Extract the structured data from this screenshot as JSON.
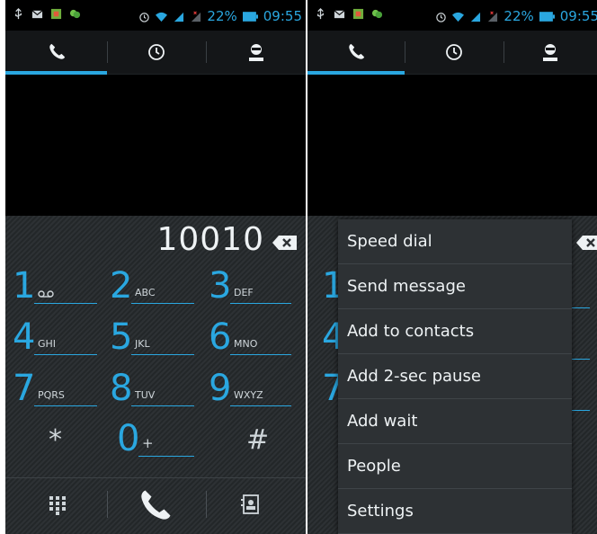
{
  "status_bar": {
    "battery": "22%",
    "time": "09:55",
    "time_partial": "09:55"
  },
  "tabs": [
    {
      "icon": "phone-icon",
      "active": true
    },
    {
      "icon": "clock-icon",
      "active": false
    },
    {
      "icon": "contact-icon",
      "active": false
    }
  ],
  "dialer": {
    "number": "10010",
    "keys": [
      {
        "digit": "1",
        "letters": ""
      },
      {
        "digit": "2",
        "letters": "ABC"
      },
      {
        "digit": "3",
        "letters": "DEF"
      },
      {
        "digit": "4",
        "letters": "GHI"
      },
      {
        "digit": "5",
        "letters": "JKL"
      },
      {
        "digit": "6",
        "letters": "MNO"
      },
      {
        "digit": "7",
        "letters": "PQRS"
      },
      {
        "digit": "8",
        "letters": "TUV"
      },
      {
        "digit": "9",
        "letters": "WXYZ"
      },
      {
        "digit": "*",
        "letters": ""
      },
      {
        "digit": "0",
        "letters": "+"
      },
      {
        "digit": "#",
        "letters": ""
      }
    ]
  },
  "menu": {
    "items": [
      "Speed dial",
      "Send message",
      "Add to contacts",
      "Add 2-sec pause",
      "Add wait",
      "People",
      "Settings"
    ]
  },
  "colors": {
    "accent": "#2aa7e0",
    "background": "#000000",
    "menu_bg": "#2d3134"
  }
}
